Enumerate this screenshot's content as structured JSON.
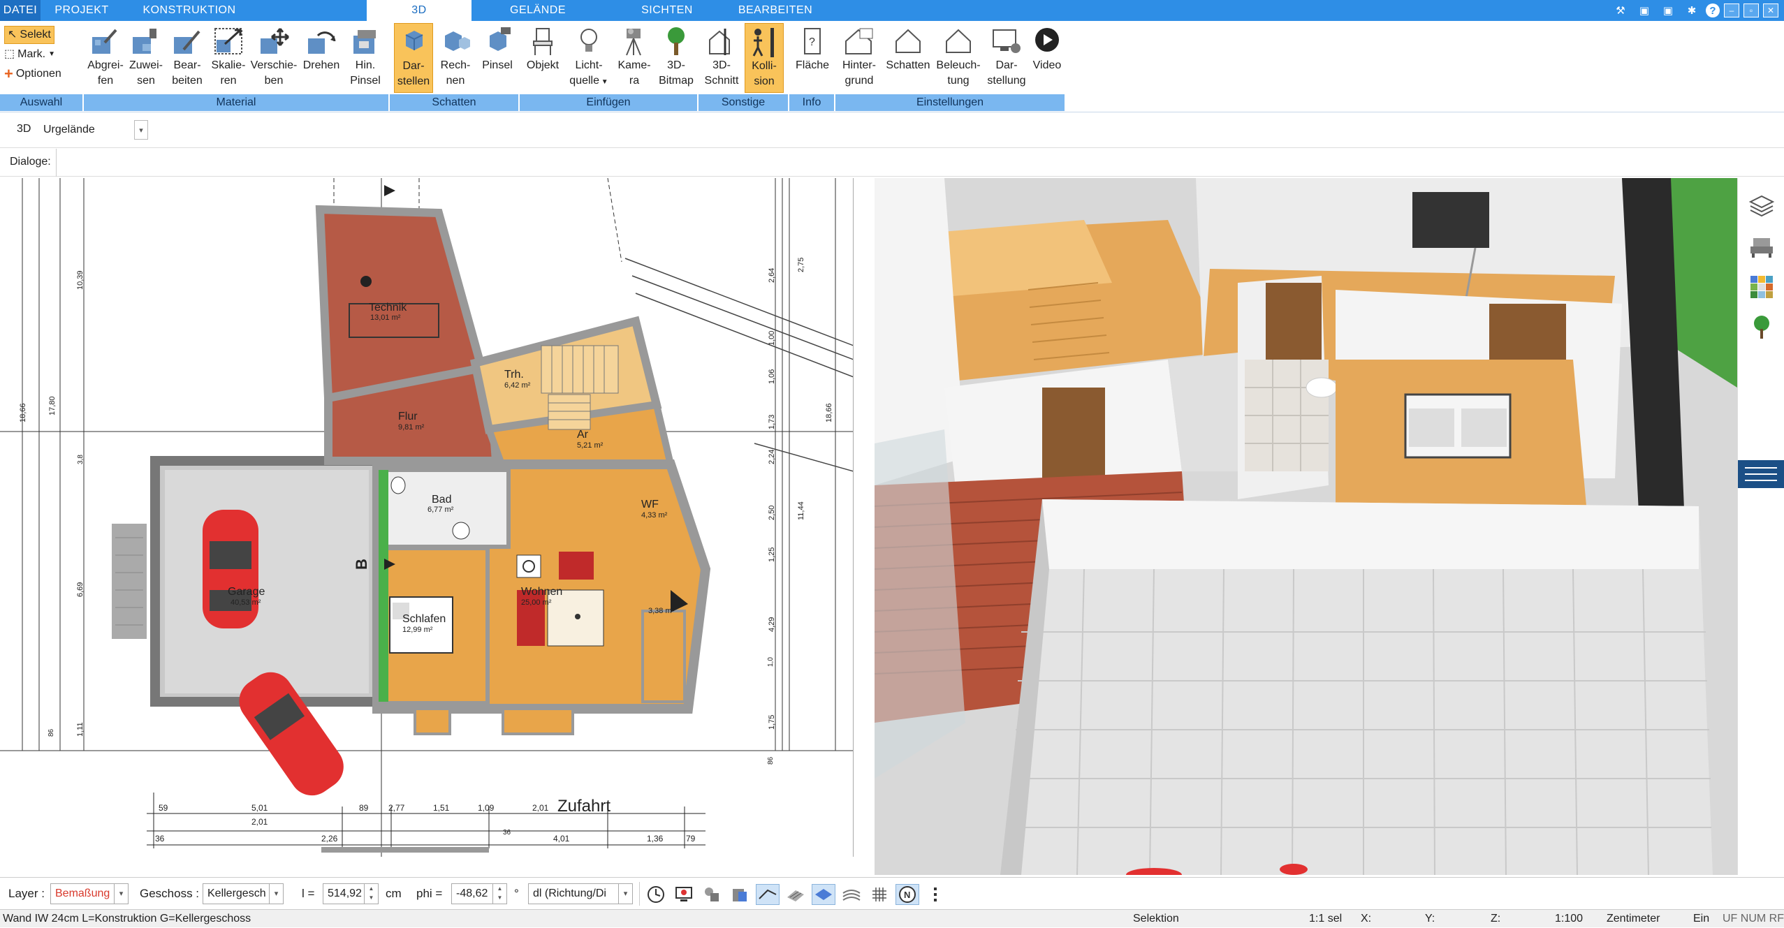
{
  "tabs": [
    {
      "label": "DATEI"
    },
    {
      "label": "PROJEKT"
    },
    {
      "label": "KONSTRUKTION"
    },
    {
      "label": "3D"
    },
    {
      "label": "GELÄNDE"
    },
    {
      "label": "SICHTEN"
    },
    {
      "label": "BEARBEITEN"
    }
  ],
  "window_controls": [
    "tools-icon",
    "folder-icon",
    "folder-icon",
    "settings-icon",
    "help-icon",
    "minimize",
    "restore",
    "close"
  ],
  "ribbon": {
    "auswahl": {
      "label": "Auswahl",
      "items": [
        "Selekt",
        "Mark.",
        "Optionen"
      ]
    },
    "material": {
      "label": "Material",
      "buttons": [
        {
          "l1": "Abgrei-",
          "l2": "fen",
          "icon": "pipette-icon"
        },
        {
          "l1": "Zuwei-",
          "l2": "sen",
          "icon": "assign-icon"
        },
        {
          "l1": "Bear-",
          "l2": "beiten",
          "icon": "edit-material-icon"
        },
        {
          "l1": "Skalie-",
          "l2": "ren",
          "icon": "scale-icon"
        },
        {
          "l1": "Verschie-",
          "l2": "ben",
          "icon": "move-icon"
        },
        {
          "l1": "Drehen",
          "l2": "",
          "icon": "rotate-icon"
        },
        {
          "l1": "Hin.",
          "l2": "Pinsel",
          "icon": "brush-icon"
        }
      ]
    },
    "schatten": {
      "label": "Schatten",
      "buttons": [
        {
          "l1": "Dar-",
          "l2": "stellen",
          "icon": "cube-shade-icon"
        },
        {
          "l1": "Rech-",
          "l2": "nen",
          "icon": "cube-calc-icon"
        },
        {
          "l1": "Pinsel",
          "l2": "",
          "icon": "cube-brush-icon"
        }
      ]
    },
    "einfuegen": {
      "label": "Einfügen",
      "buttons": [
        {
          "l1": "Objekt",
          "l2": "",
          "icon": "chair-icon"
        },
        {
          "l1": "Licht-",
          "l2": "quelle",
          "icon": "bulb-icon"
        },
        {
          "l1": "Kame-",
          "l2": "ra",
          "icon": "camera-icon"
        },
        {
          "l1": "3D-",
          "l2": "Bitmap",
          "icon": "tree-icon"
        }
      ]
    },
    "sonstige": {
      "label": "Sonstige",
      "buttons": [
        {
          "l1": "3D-",
          "l2": "Schnitt",
          "icon": "section-icon"
        },
        {
          "l1": "Kolli-",
          "l2": "sion",
          "icon": "collision-icon"
        }
      ]
    },
    "info": {
      "label": "Info",
      "buttons": [
        {
          "l1": "Fläche",
          "l2": "",
          "icon": "area-icon"
        }
      ]
    },
    "einstellungen": {
      "label": "Einstellungen",
      "buttons": [
        {
          "l1": "Hinter-",
          "l2": "grund",
          "icon": "background-icon"
        },
        {
          "l1": "Schatten",
          "l2": "",
          "icon": "house-shadow-icon"
        },
        {
          "l1": "Beleuch-",
          "l2": "tung",
          "icon": "house-light-icon"
        },
        {
          "l1": "Dar-",
          "l2": "stellung",
          "icon": "display-icon"
        },
        {
          "l1": "Video",
          "l2": "",
          "icon": "play-icon"
        }
      ]
    }
  },
  "bar3d": {
    "mode": "3D",
    "terrain": "Urgelände"
  },
  "dialog_label": "Dialoge:",
  "plan": {
    "rooms": [
      {
        "name": "Technik",
        "area": "13,01 m²"
      },
      {
        "name": "Trh.",
        "area": "6,42 m²"
      },
      {
        "name": "Flur",
        "area": "9,81 m²"
      },
      {
        "name": "Ar",
        "area": "5,21 m²"
      },
      {
        "name": "Bad",
        "area": "6,77 m²"
      },
      {
        "name": "WF",
        "area": "4,33 m²"
      },
      {
        "name": "Garage",
        "area": "40,53 m²"
      },
      {
        "name": "Wohnen",
        "area": "25,00 m²"
      },
      {
        "name": "Schlafen",
        "area": "12,99 m²"
      },
      {
        "name": "",
        "area": "3,38 m²"
      }
    ],
    "zufahrt": "Zufahrt",
    "section_label": "B",
    "vdims": [
      "10,39",
      "17,80",
      "18,66",
      "6,69",
      "1,11",
      "2,64",
      "1,00",
      "1,06",
      "1,73",
      "2,24",
      "2,50",
      "11,44",
      "1,25",
      "4,29",
      "1,75",
      "2,75",
      "18,66"
    ],
    "hdims_top": [
      "59",
      "5,01",
      "89",
      "2,77",
      "1,51",
      "1,09",
      "2,01"
    ],
    "hdims_bottom": [
      "36",
      "2,01",
      "2,26",
      "4,01",
      "1,36",
      "79"
    ],
    "small_dims": [
      "3,8",
      "86",
      "86",
      "1,0",
      "36"
    ]
  },
  "bottombar": {
    "layer_label": "Layer :",
    "layer_value": "Bemaßung",
    "geschoss_label": "Geschoss :",
    "geschoss_value": "Kellergesch",
    "l_label": "l =",
    "l_value": "514,92",
    "l_unit": "cm",
    "phi_label": "phi =",
    "phi_value": "-48,62",
    "phi_unit": "°",
    "dl_value": "dl (Richtung/Di"
  },
  "status": {
    "left": "Wand IW 24cm L=Konstruktion G=Kellergeschoss",
    "mode": "Selektion",
    "sel": "1:1 sel",
    "x": "X:",
    "y": "Y:",
    "z": "Z:",
    "scale": "1:100",
    "unit": "Zentimeter",
    "ein": "Ein",
    "flags": "UF NUM RF"
  },
  "colors": {
    "tabbar": "#2e8ee6",
    "ribbon_group": "#7ab7f0",
    "selected": "#f9c35a",
    "floor_wood": "#e8a54a",
    "floor_red": "#b8533e",
    "car": "#e23030"
  }
}
